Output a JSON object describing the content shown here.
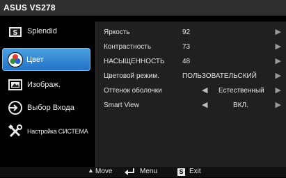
{
  "window": {
    "title": "ASUS VS278"
  },
  "sidebar": {
    "items": [
      {
        "label": "Splendid",
        "icon": "splendid-icon",
        "selected": false
      },
      {
        "label": "Цвет",
        "icon": "color-palette-icon",
        "selected": true
      },
      {
        "label": "Изображ.",
        "icon": "image-icon",
        "selected": false
      },
      {
        "label": "Выбор Входа",
        "icon": "input-select-icon",
        "selected": false
      },
      {
        "label": "Настройка СИСТЕМА",
        "icon": "wrench-screwdriver-icon",
        "selected": false
      }
    ]
  },
  "panel": {
    "rows": [
      {
        "label": "Яркость",
        "value": "92"
      },
      {
        "label": "Контрастность",
        "value": "73"
      },
      {
        "label": "НАСЫЩЕННОСТЬ",
        "value": "48"
      },
      {
        "label": "Цветовой режим.",
        "value": "ПОЛЬЗОВАТЕЛЬСКИЙ"
      },
      {
        "label": "Оттенок оболочки",
        "value": "Естественный"
      },
      {
        "label": "Smart View",
        "value": "ВКЛ."
      }
    ]
  },
  "footer": {
    "move": "Move",
    "menu": "Menu",
    "exit": "Exit",
    "exit_key": "S"
  },
  "colors": {
    "accent": "#2a7fd4",
    "panel": "#202020",
    "titlebar": "#2f2f2f"
  }
}
